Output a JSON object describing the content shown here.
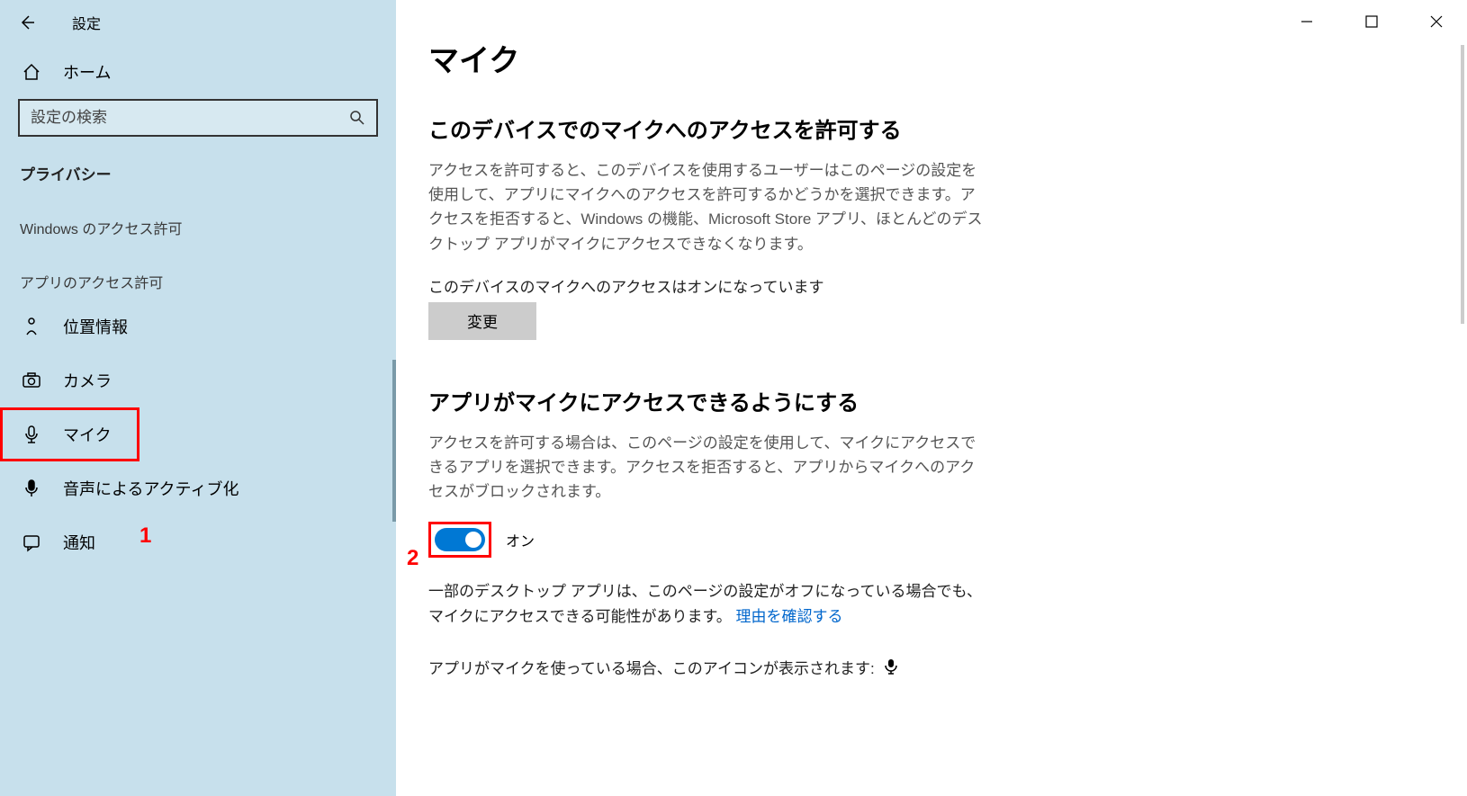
{
  "window": {
    "title": "設定"
  },
  "sidebar": {
    "home": "ホーム",
    "search_placeholder": "設定の検索",
    "section": "プライバシー",
    "group_windows": "Windows のアクセス許可",
    "group_apps": "アプリのアクセス許可",
    "items": [
      {
        "label": "位置情報"
      },
      {
        "label": "カメラ"
      },
      {
        "label": "マイク"
      },
      {
        "label": "音声によるアクティブ化"
      },
      {
        "label": "通知"
      }
    ]
  },
  "annotations": {
    "one": "1",
    "two": "2"
  },
  "main": {
    "title": "マイク",
    "section1": {
      "heading": "このデバイスでのマイクへのアクセスを許可する",
      "desc": "アクセスを許可すると、このデバイスを使用するユーザーはこのページの設定を使用して、アプリにマイクへのアクセスを許可するかどうかを選択できます。アクセスを拒否すると、Windows の機能、Microsoft Store アプリ、ほとんどのデスクトップ アプリがマイクにアクセスできなくなります。",
      "status": "このデバイスのマイクへのアクセスはオンになっています",
      "button": "変更"
    },
    "section2": {
      "heading": "アプリがマイクにアクセスできるようにする",
      "desc": "アクセスを許可する場合は、このページの設定を使用して、マイクにアクセスできるアプリを選択できます。アクセスを拒否すると、アプリからマイクへのアクセスがブロックされます。",
      "toggle_label": "オン",
      "note_prefix": "一部のデスクトップ アプリは、このページの設定がオフになっている場合でも、マイクにアクセスできる可能性があります。 ",
      "note_link": "理由を確認する",
      "icon_line": "アプリがマイクを使っている場合、このアイコンが表示されます:"
    }
  }
}
